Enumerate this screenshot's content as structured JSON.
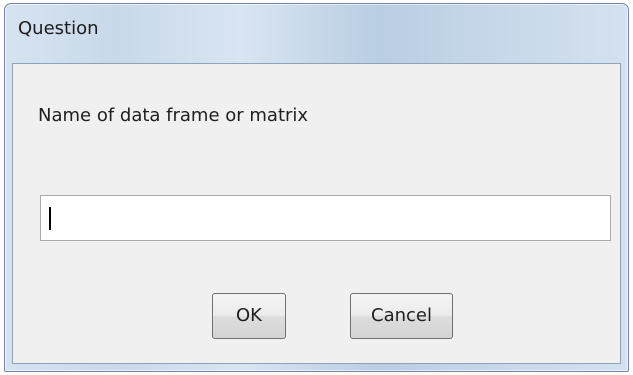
{
  "window": {
    "title": "Question"
  },
  "dialog": {
    "prompt": "Name of data frame or matrix",
    "input_value": "",
    "ok_label": "OK",
    "cancel_label": "Cancel"
  },
  "colors": {
    "titlebar_gradient": "#c9d9ea",
    "client_background": "#f0f0f0",
    "window_border": "#6f8aa6"
  }
}
